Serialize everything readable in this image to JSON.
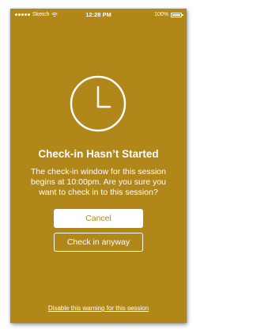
{
  "status_bar": {
    "carrier": "Sketch",
    "time": "12:28 PM",
    "battery": "100%"
  },
  "colors": {
    "background": "#b1871a",
    "foreground": "#ffffff"
  },
  "icon": "clock-icon",
  "dialog": {
    "title": "Check-in Hasn’t Started",
    "message": "The check-in window for this session begins at 10:00pm. Are you sure you want to check in to this session?",
    "cancel_label": "Cancel",
    "checkin_label": "Check in anyway"
  },
  "footer": {
    "disable_link": "Disable this warning for this session"
  }
}
